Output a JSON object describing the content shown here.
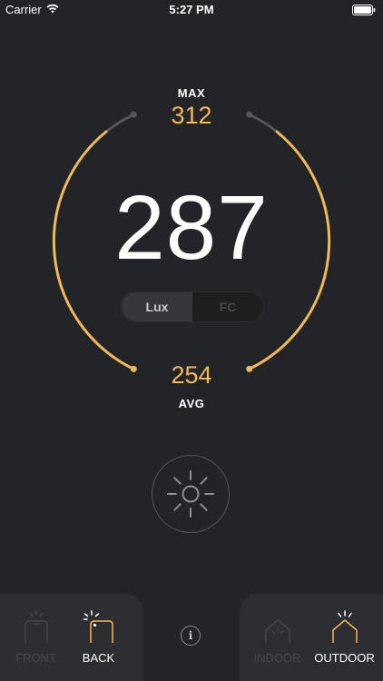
{
  "status_bar": {
    "carrier": "Carrier",
    "time": "5:27 PM"
  },
  "meter": {
    "max_label": "MAX",
    "max_value": "312",
    "current_value": "287",
    "avg_value": "254",
    "avg_label": "AVG"
  },
  "units": {
    "options": [
      "Lux",
      "FC"
    ],
    "selected": "Lux"
  },
  "sensor_mode": {
    "front_label": "FRONT",
    "back_label": "BACK",
    "selected": "BACK"
  },
  "environment_mode": {
    "indoor_label": "INDOOR",
    "outdoor_label": "OUTDOOR",
    "selected": "OUTDOOR"
  },
  "info_glyph": "i",
  "colors": {
    "accent": "#f1b958",
    "background": "#232427",
    "panel": "#2d2e31"
  },
  "icons": [
    "wifi-icon",
    "battery-icon",
    "sun-icon",
    "phone-front-icon",
    "phone-back-icon",
    "info-icon",
    "house-indoor-icon",
    "house-outdoor-icon"
  ]
}
